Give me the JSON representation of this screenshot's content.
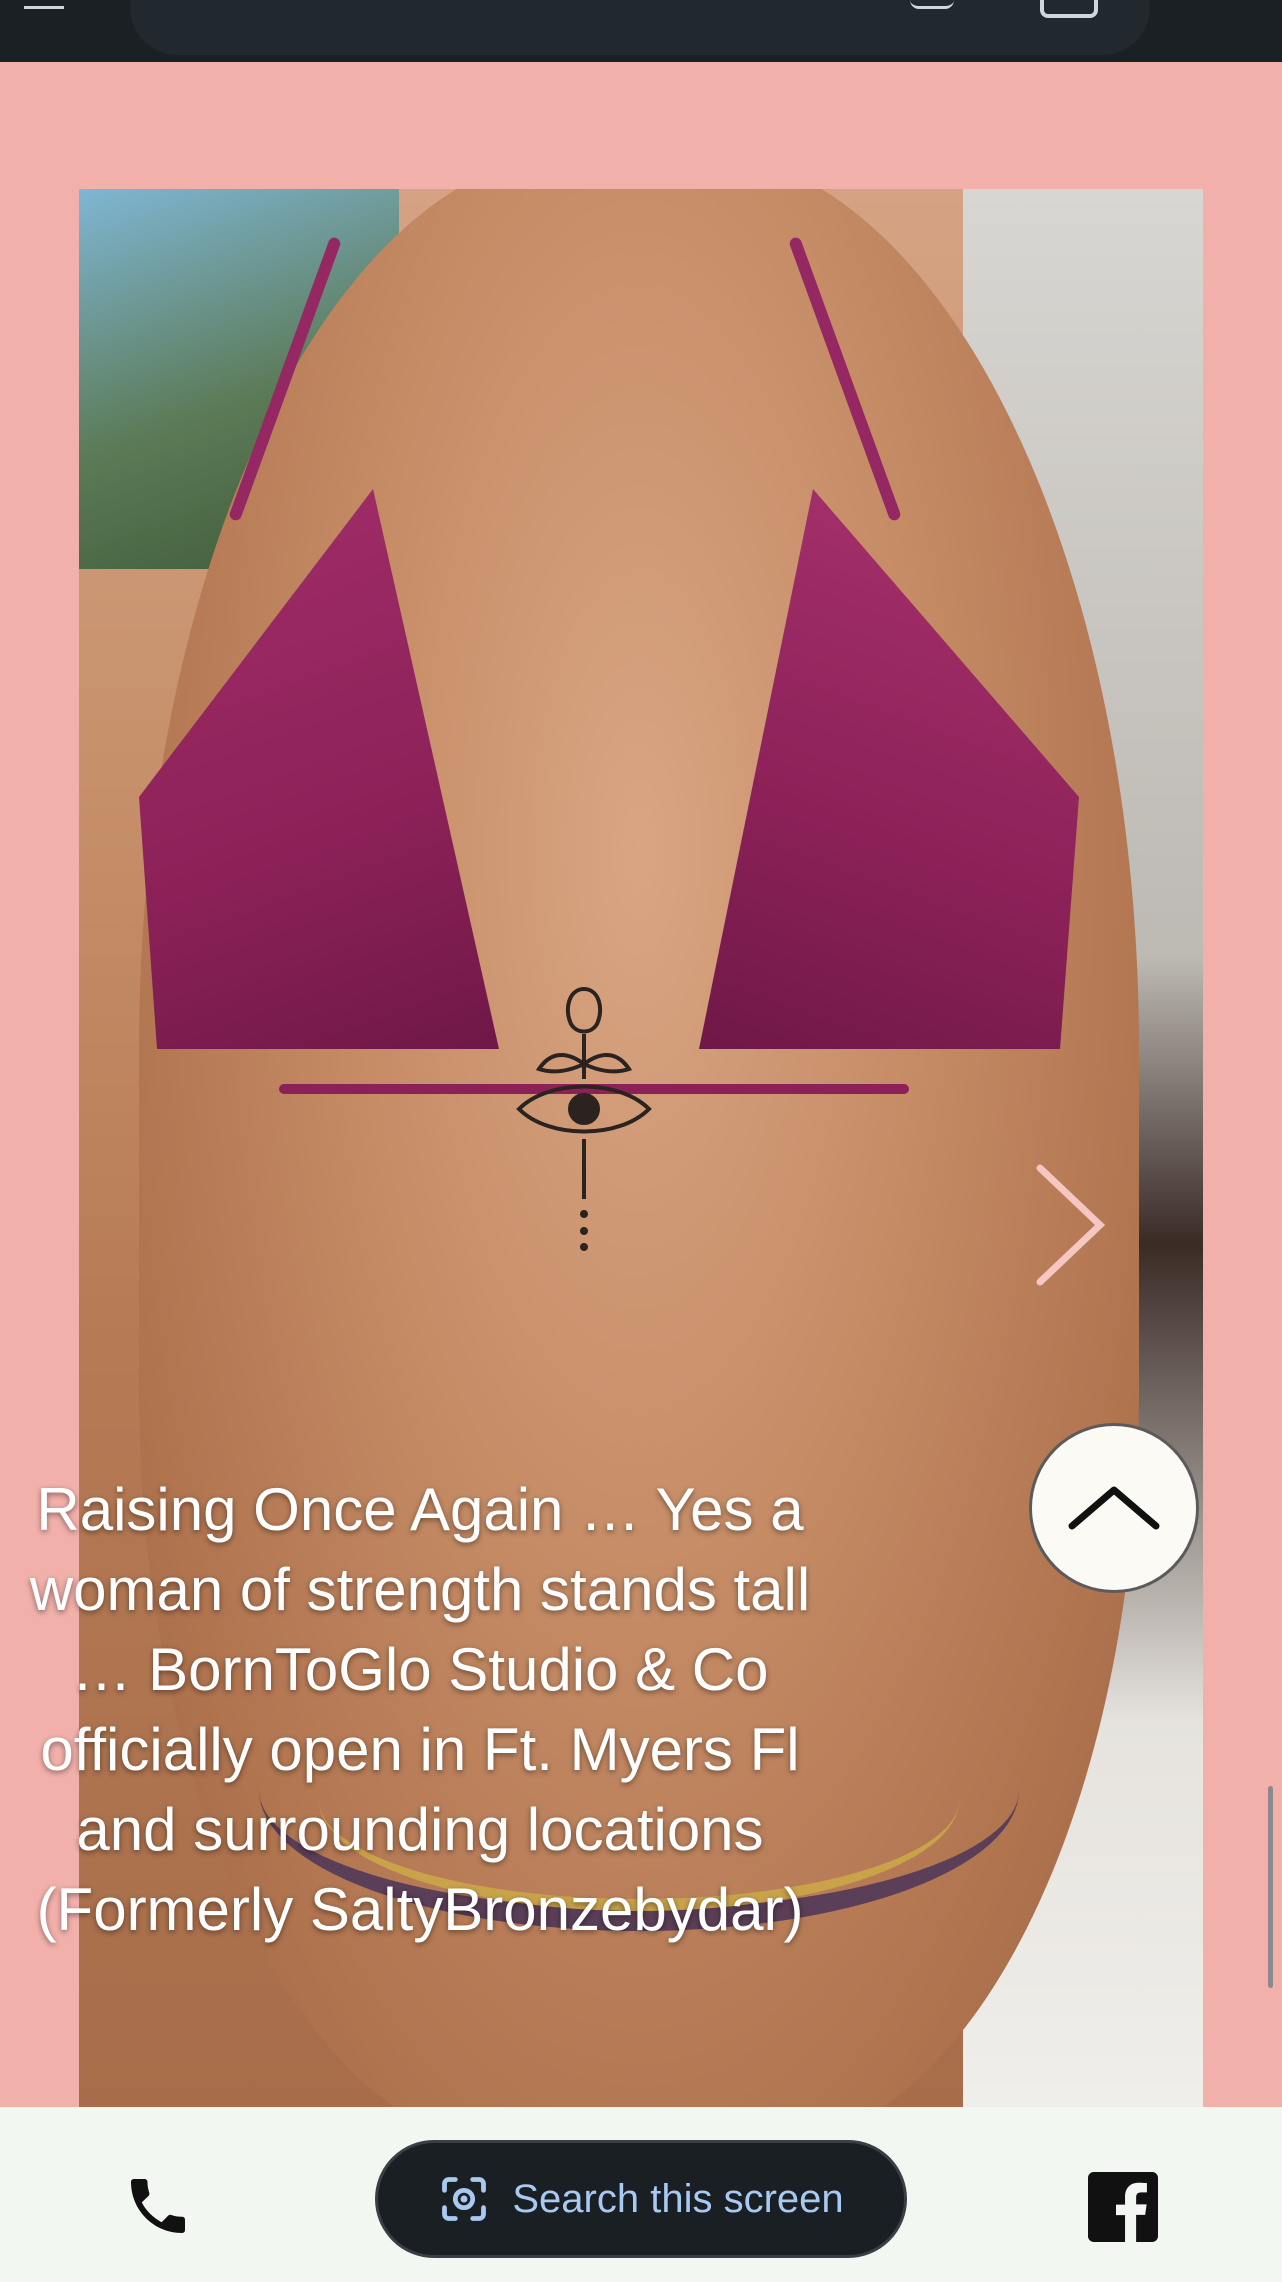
{
  "caption": {
    "text": "Raising Once Again … Yes a woman of strength stands tall … BornToGlo Studio & Co officially open in Ft. Myers Fl and surrounding locations (Formerly SaltyBronzebydar)"
  },
  "bottom_bar": {
    "search_label": "Search this screen"
  },
  "icons": {
    "next": "chevron-right-icon",
    "scroll_top": "chevron-up-icon",
    "phone": "phone-icon",
    "lens": "lens-icon",
    "facebook": "facebook-icon"
  },
  "colors": {
    "page_background": "#f2b0aa",
    "top_bar": "#1b2024",
    "bottom_bar": "#f2f7f1",
    "search_pill": "#1a1f23",
    "search_text": "#a8c9f2",
    "swimsuit": "#8c2158"
  }
}
